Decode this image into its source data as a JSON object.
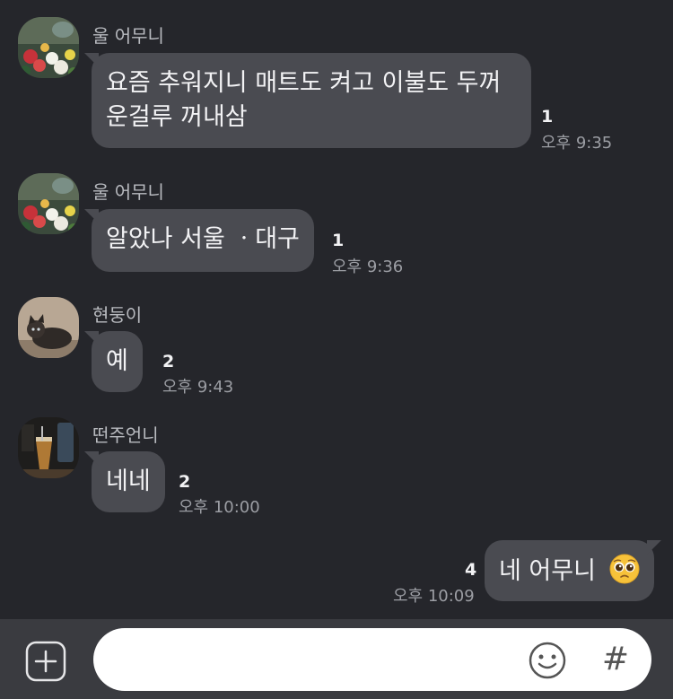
{
  "messages": [
    {
      "sender": "울 어무니",
      "avatar": "flowers-avatar",
      "lines": [
        "요즘 추워지니 매트도 켜고 이불도 두꺼",
        "운걸루 꺼내삼"
      ],
      "unread": "1",
      "time": "오후 9:35"
    },
    {
      "sender": "울 어무니",
      "avatar": "flowers-avatar",
      "text": "알았나 서울 ㆍ대구",
      "unread": "1",
      "time": "오후 9:36"
    },
    {
      "sender": "현둥이",
      "avatar": "cat-avatar",
      "text": "예",
      "unread": "2",
      "time": "오후 9:43"
    },
    {
      "sender": "떤주언니",
      "avatar": "drink-avatar",
      "text": "네네",
      "unread": "2",
      "time": "오후 10:00"
    }
  ],
  "my_message": {
    "text": "네 어무니",
    "emoji": "pleading-face-emoji",
    "unread": "4",
    "time": "오후 10:09"
  },
  "input_bar": {
    "placeholder": "",
    "hash_label": "#"
  },
  "colors": {
    "background": "#25262b",
    "bubble": "#4a4b51",
    "input_bar": "#3a3b40"
  }
}
